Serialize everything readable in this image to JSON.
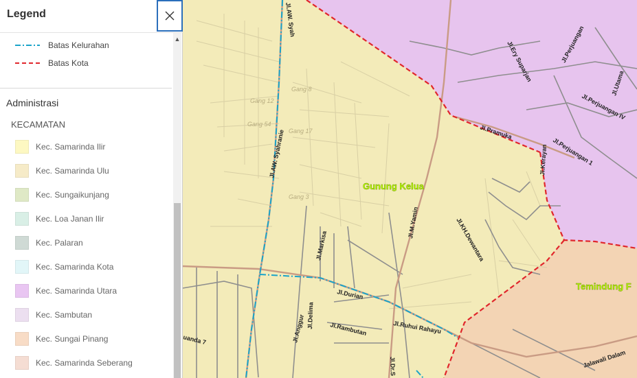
{
  "legend": {
    "title": "Legend",
    "line_items": [
      {
        "label": "Batas Kelurahan",
        "color": "#1aa3c9",
        "dash": "dash-dot"
      },
      {
        "label": "Batas Kota",
        "color": "#e0262b",
        "dash": "dashed"
      }
    ],
    "group_title": "Administrasi",
    "layer_title": "KECAMATAN",
    "polygon_items": [
      {
        "label": "Kec. Samarinda Ilir",
        "color": "#fdf8c2"
      },
      {
        "label": "Kec. Samarinda Ulu",
        "color": "#f6ebc8"
      },
      {
        "label": "Kec. Sungaikunjang",
        "color": "#dfe9c6"
      },
      {
        "label": "Kec. Loa Janan Ilir",
        "color": "#d9efe6"
      },
      {
        "label": "Kec. Palaran",
        "color": "#cfdad5"
      },
      {
        "label": "Kec. Samarinda Kota",
        "color": "#e2f6f8"
      },
      {
        "label": "Kec. Samarinda Utara",
        "color": "#e9c6f2"
      },
      {
        "label": "Kec. Sambutan",
        "color": "#ecdff0"
      },
      {
        "label": "Kec. Sungai Pinang",
        "color": "#f8dcc6"
      },
      {
        "label": "Kec. Samarinda Seberang",
        "color": "#f5ddd3"
      }
    ]
  },
  "map": {
    "area_labels": {
      "gunung_kelua": "Gunung Kelua",
      "temindung": "Temindung F"
    },
    "streets": {
      "aw_syahranie_top": "Jl.AW. Syah",
      "aw_syahranie": "Jl.AW. Syahranie",
      "ery_suparjan": "Jl.Ery Suparjan",
      "perjuangan": "Jl.Perjuangan",
      "utama": "Jl.Utama",
      "perjuangan_iv": "Jl.Perjuangan IV",
      "pramuka": "Jl.Pramuka",
      "perjuangan_1": "Jl.Perjuangan 1",
      "kerayan": "Jl.Kerayan",
      "m_yamin": "Jl.M.Yamin",
      "kh_dewantara": "Jl.KH.Dewantara",
      "markisa": "Jl.Markisa",
      "durian": "Jl.Durian",
      "delima": "Jl.Delima",
      "anggur": "Jl.Anggur",
      "rambutan": "Jl.Rambutan",
      "ruhui_rahayu": "Jl.Ruhui Rahayu",
      "uanda": "uanda 7",
      "dr_s": "Jl.Dr.S",
      "jalawali": "Jalawali Dalam"
    },
    "gangs": {
      "gang_12": "Gang 12",
      "gang_8": "Gang 8",
      "gang_54": "Gang 54",
      "gang_17": "Gang 17",
      "gang_3": "Gang 3"
    },
    "colors": {
      "ulu": "#f3ebb9",
      "utara": "#e7c4ee",
      "sungai_pinang": "#f3d4b4",
      "kota_boundary": "#e0262b",
      "kelurahan_boundary": "#1aa3c9"
    }
  }
}
